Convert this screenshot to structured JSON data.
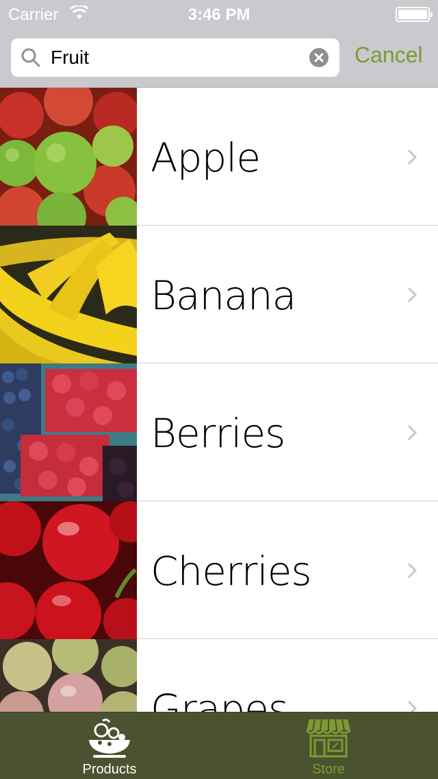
{
  "status_bar": {
    "carrier": "Carrier",
    "time": "3:46 PM"
  },
  "search": {
    "value": "Fruit",
    "cancel_label": "Cancel"
  },
  "items": [
    {
      "label": "Apple"
    },
    {
      "label": "Banana"
    },
    {
      "label": "Berries"
    },
    {
      "label": "Cherries"
    },
    {
      "label": "Grapes"
    }
  ],
  "tabs": [
    {
      "label": "Products",
      "icon": "fruit-bowl-icon",
      "selected": true
    },
    {
      "label": "Store",
      "icon": "storefront-icon",
      "selected": false
    }
  ],
  "colors": {
    "accent": "#7f9a32",
    "tab_bar": "#4a5230",
    "header": "#c9c9ce"
  }
}
